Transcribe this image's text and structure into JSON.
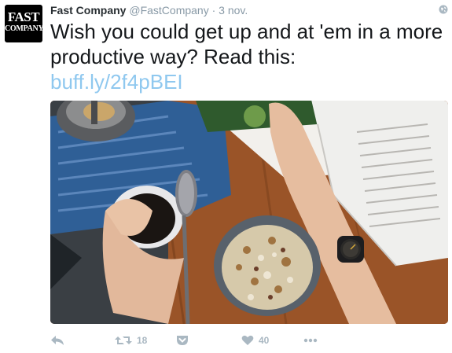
{
  "tweet": {
    "author_name": "Fast Company",
    "handle": "@FastCompany",
    "separator": "·",
    "time": "3 nov.",
    "avatar_top": "FAST",
    "avatar_bottom": "COMPANY",
    "text": "Wish you could get up and at 'em in a more productive way? Read this:",
    "link": "buff.ly/2f4pBEI"
  },
  "actions": {
    "retweet_count": "18",
    "like_count": "40"
  },
  "icons": [
    "globe-icon",
    "reply-icon",
    "retweet-icon",
    "pocket-icon",
    "heart-icon",
    "more-icon"
  ],
  "colors": {
    "link": "#8fc8ef",
    "muted": "#8899a6",
    "action": "#aab8c2"
  }
}
